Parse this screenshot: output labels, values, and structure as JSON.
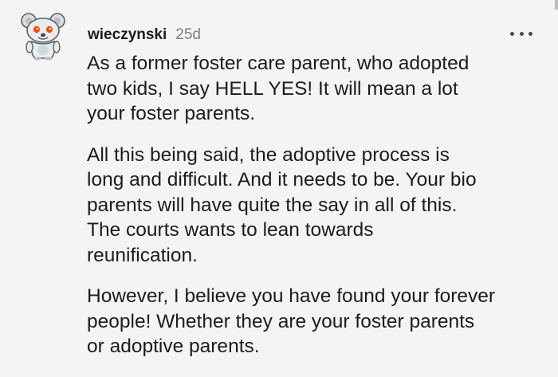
{
  "comment": {
    "author": "wieczynski",
    "age": "25d",
    "avatar_icon": "snoo-avatar-icon",
    "more_icon": "more-options-icon",
    "paragraphs": [
      {
        "lines": [
          "As a former foster care parent, who adopted",
          "two kids, I say HELL YES! It will mean a lot",
          "your foster parents."
        ]
      },
      {
        "lines": [
          "All this being said, the adoptive process is",
          "long and difficult. And it needs to be. Your bio",
          "parents will have quite the say in all of this.",
          "The courts wants to lean towards",
          "reunification."
        ]
      },
      {
        "lines": [
          "However, I believe you have found your forever",
          "people! Whether they are your foster parents",
          "or adoptive parents."
        ]
      }
    ]
  },
  "colors": {
    "background": "#f4f4f4",
    "text": "#1c1c1c",
    "meta": "#7c7c7c",
    "avatar_accent": "#ff4500"
  }
}
